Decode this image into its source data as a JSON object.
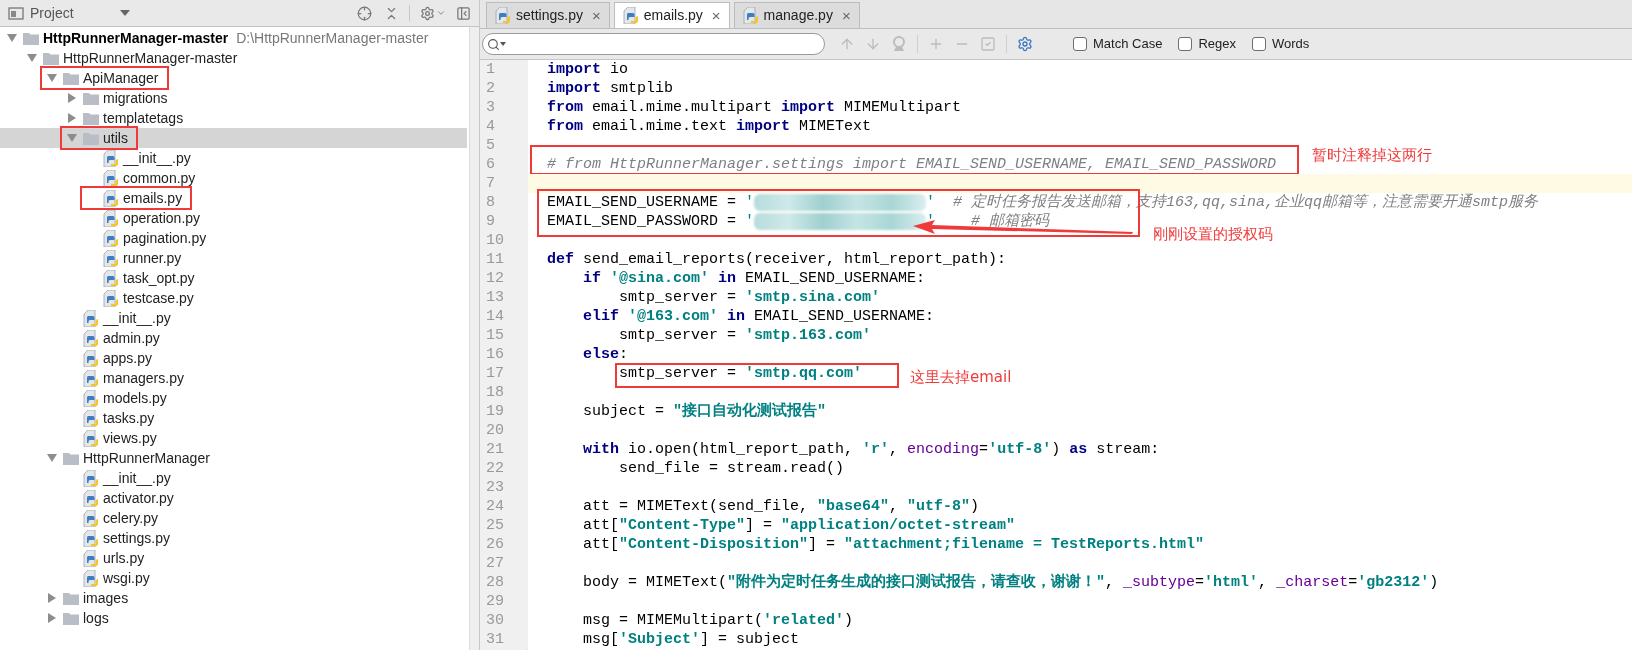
{
  "project_panel": {
    "title": "Project",
    "tree": [
      {
        "label": "HttpRunnerManager-master",
        "path": "D:\\HttpRunnerManager-master",
        "kind": "folder",
        "expanded": true,
        "selected": false,
        "boxed": false,
        "children": [
          {
            "label": "HttpRunnerManager-master",
            "kind": "folder",
            "expanded": true,
            "selected": false,
            "boxed": false,
            "children": [
              {
                "label": "ApiManager",
                "kind": "folder",
                "expanded": true,
                "selected": false,
                "boxed": true,
                "children": [
                  {
                    "label": "migrations",
                    "kind": "folder",
                    "expanded": false,
                    "selected": false,
                    "boxed": false
                  },
                  {
                    "label": "templatetags",
                    "kind": "folder",
                    "expanded": false,
                    "selected": false,
                    "boxed": false
                  },
                  {
                    "label": "utils",
                    "kind": "folder",
                    "expanded": true,
                    "selected": true,
                    "boxed": true,
                    "children": [
                      {
                        "label": "__init__.py",
                        "kind": "python",
                        "selected": false,
                        "boxed": false
                      },
                      {
                        "label": "common.py",
                        "kind": "python",
                        "selected": false,
                        "boxed": false
                      },
                      {
                        "label": "emails.py",
                        "kind": "python",
                        "selected": false,
                        "boxed": true
                      },
                      {
                        "label": "operation.py",
                        "kind": "python",
                        "selected": false,
                        "boxed": false
                      },
                      {
                        "label": "pagination.py",
                        "kind": "python",
                        "selected": false,
                        "boxed": false
                      },
                      {
                        "label": "runner.py",
                        "kind": "python",
                        "selected": false,
                        "boxed": false
                      },
                      {
                        "label": "task_opt.py",
                        "kind": "python",
                        "selected": false,
                        "boxed": false
                      },
                      {
                        "label": "testcase.py",
                        "kind": "python",
                        "selected": false,
                        "boxed": false
                      }
                    ]
                  },
                  {
                    "label": "__init__.py",
                    "kind": "python",
                    "selected": false,
                    "boxed": false
                  },
                  {
                    "label": "admin.py",
                    "kind": "python",
                    "selected": false,
                    "boxed": false
                  },
                  {
                    "label": "apps.py",
                    "kind": "python",
                    "selected": false,
                    "boxed": false
                  },
                  {
                    "label": "managers.py",
                    "kind": "python",
                    "selected": false,
                    "boxed": false
                  },
                  {
                    "label": "models.py",
                    "kind": "python",
                    "selected": false,
                    "boxed": false
                  },
                  {
                    "label": "tasks.py",
                    "kind": "python",
                    "selected": false,
                    "boxed": false
                  },
                  {
                    "label": "views.py",
                    "kind": "python",
                    "selected": false,
                    "boxed": false
                  }
                ]
              },
              {
                "label": "HttpRunnerManager",
                "kind": "folder",
                "expanded": true,
                "selected": false,
                "boxed": false,
                "children": [
                  {
                    "label": "__init__.py",
                    "kind": "python",
                    "selected": false,
                    "boxed": false
                  },
                  {
                    "label": "activator.py",
                    "kind": "python",
                    "selected": false,
                    "boxed": false
                  },
                  {
                    "label": "celery.py",
                    "kind": "python",
                    "selected": false,
                    "boxed": false
                  },
                  {
                    "label": "settings.py",
                    "kind": "python",
                    "selected": false,
                    "boxed": false
                  },
                  {
                    "label": "urls.py",
                    "kind": "python",
                    "selected": false,
                    "boxed": false
                  },
                  {
                    "label": "wsgi.py",
                    "kind": "python",
                    "selected": false,
                    "boxed": false
                  }
                ]
              },
              {
                "label": "images",
                "kind": "folder",
                "expanded": false,
                "selected": false,
                "boxed": false
              },
              {
                "label": "logs",
                "kind": "folder",
                "expanded": false,
                "selected": false,
                "boxed": false
              }
            ]
          }
        ]
      }
    ]
  },
  "editor": {
    "tabs": [
      {
        "label": "settings.py",
        "selected": false,
        "close": "×"
      },
      {
        "label": "emails.py",
        "selected": true,
        "close": "×"
      },
      {
        "label": "manage.py",
        "selected": false,
        "close": "×"
      }
    ],
    "find_bar": {
      "options": [
        {
          "label": "Match Case",
          "checked": false
        },
        {
          "label": "Regex",
          "checked": false
        },
        {
          "label": "Words",
          "checked": false
        }
      ]
    },
    "code": {
      "groups": [
        {
          "boxed": false,
          "lines": [
            {
              "number": "1",
              "current": false,
              "tokens": [
                {
                  "kind": "k",
                  "text": "import"
                },
                {
                  "kind": "p",
                  "text": " io"
                }
              ]
            },
            {
              "number": "2",
              "current": false,
              "tokens": [
                {
                  "kind": "k",
                  "text": "import"
                },
                {
                  "kind": "p",
                  "text": " smtplib"
                }
              ]
            },
            {
              "number": "3",
              "current": false,
              "tokens": [
                {
                  "kind": "k",
                  "text": "from"
                },
                {
                  "kind": "p",
                  "text": " email.mime.multipart "
                },
                {
                  "kind": "k",
                  "text": "import"
                },
                {
                  "kind": "p",
                  "text": " MIMEMultipart"
                }
              ]
            },
            {
              "number": "4",
              "current": false,
              "tokens": [
                {
                  "kind": "k",
                  "text": "from"
                },
                {
                  "kind": "p",
                  "text": " email.mime.text "
                },
                {
                  "kind": "k",
                  "text": "import"
                },
                {
                  "kind": "p",
                  "text": " MIMEText"
                }
              ]
            }
          ]
        },
        {
          "boxed": true,
          "pointer": false,
          "note": "暂时注释掉这两行",
          "lines": [
            {
              "number": "5",
              "current": false
            },
            {
              "number": "6",
              "current": false,
              "tokens": [
                {
                  "kind": "c",
                  "text": "# from HttpRunnerManager.settings import EMAIL_SEND_USERNAME, EMAIL_SEND_PASSWORD"
                }
              ]
            }
          ]
        },
        {
          "boxed": false,
          "lines": [
            {
              "number": "7",
              "current": true
            }
          ]
        },
        {
          "boxed": true,
          "pointer": true,
          "note": "刚刚设置的授权码",
          "lines": [
            {
              "number": "8",
              "current": false,
              "tokens": [
                {
                  "kind": "p",
                  "text": "EMAIL_SEND_USERNAME = "
                },
                {
                  "kind": "q",
                  "text": "'"
                },
                {
                  "kind": "r"
                },
                {
                  "kind": "q",
                  "text": "'"
                },
                {
                  "kind": "c",
                  "text": "  # 定时任务报告发送邮箱，支持163,qq,sina,企业qq邮箱等，注意需要开通smtp服务"
                }
              ]
            },
            {
              "number": "9",
              "current": false,
              "tokens": [
                {
                  "kind": "p",
                  "text": "EMAIL_SEND_PASSWORD = "
                },
                {
                  "kind": "q",
                  "text": "'"
                },
                {
                  "kind": "r"
                },
                {
                  "kind": "q",
                  "text": "'"
                },
                {
                  "kind": "c",
                  "text": "    # 邮箱密码"
                }
              ]
            }
          ]
        },
        {
          "boxed": false,
          "lines": [
            {
              "number": "10",
              "current": false
            },
            {
              "number": "11",
              "current": false,
              "tokens": [
                {
                  "kind": "k",
                  "text": "def"
                },
                {
                  "kind": "p",
                  "text": " send_email_reports(receiver, html_report_path):"
                }
              ]
            },
            {
              "number": "12",
              "current": false,
              "tokens": [
                {
                  "kind": "k",
                  "text": "    if "
                },
                {
                  "kind": "s",
                  "text": "'@sina.com' "
                },
                {
                  "kind": "k",
                  "text": "in"
                },
                {
                  "kind": "p",
                  "text": " EMAIL_SEND_USERNAME:"
                }
              ]
            },
            {
              "number": "13",
              "current": false,
              "tokens": [
                {
                  "kind": "p",
                  "text": "        smtp_server = "
                },
                {
                  "kind": "s",
                  "text": "'smtp.sina.com'"
                }
              ]
            },
            {
              "number": "14",
              "current": false,
              "tokens": [
                {
                  "kind": "k",
                  "text": "    elif "
                },
                {
                  "kind": "s",
                  "text": "'@163.com' "
                },
                {
                  "kind": "k",
                  "text": "in"
                },
                {
                  "kind": "p",
                  "text": " EMAIL_SEND_USERNAME:"
                }
              ]
            },
            {
              "number": "15",
              "current": false,
              "tokens": [
                {
                  "kind": "p",
                  "text": "        smtp_server = "
                },
                {
                  "kind": "s",
                  "text": "'smtp.163.com'"
                }
              ]
            },
            {
              "number": "16",
              "current": false,
              "tokens": [
                {
                  "kind": "k",
                  "text": "    else"
                },
                {
                  "kind": "p",
                  "text": ":"
                }
              ]
            }
          ]
        },
        {
          "boxed": true,
          "pointer": false,
          "note": "这里去掉email",
          "lines": [
            {
              "number": "17",
              "current": false,
              "tokens": [
                {
                  "kind": "p",
                  "text": "        smtp_server = "
                },
                {
                  "kind": "s",
                  "text": "'smtp.qq.com'"
                }
              ]
            }
          ]
        },
        {
          "boxed": false,
          "lines": [
            {
              "number": "18",
              "current": false
            },
            {
              "number": "19",
              "current": false,
              "tokens": [
                {
                  "kind": "p",
                  "text": "    subject = "
                },
                {
                  "kind": "s",
                  "text": "\"接口自动化测试报告\""
                }
              ]
            },
            {
              "number": "20",
              "current": false
            },
            {
              "number": "21",
              "current": false,
              "tokens": [
                {
                  "kind": "k",
                  "text": "    with"
                },
                {
                  "kind": "p",
                  "text": " io.open(html_report_path, "
                },
                {
                  "kind": "s",
                  "text": "'r'"
                },
                {
                  "kind": "p",
                  "text": ", "
                },
                {
                  "kind": "a",
                  "text": "encoding"
                },
                {
                  "kind": "p",
                  "text": "="
                },
                {
                  "kind": "s",
                  "text": "'utf-8'"
                },
                {
                  "kind": "p",
                  "text": ") "
                },
                {
                  "kind": "k",
                  "text": "as"
                },
                {
                  "kind": "p",
                  "text": " stream:"
                }
              ]
            },
            {
              "number": "22",
              "current": false,
              "tokens": [
                {
                  "kind": "p",
                  "text": "        send_file = stream.read()"
                }
              ]
            },
            {
              "number": "23",
              "current": false
            },
            {
              "number": "24",
              "current": false,
              "tokens": [
                {
                  "kind": "p",
                  "text": "    att = MIMEText(send_file, "
                },
                {
                  "kind": "s",
                  "text": "\"base64\""
                },
                {
                  "kind": "p",
                  "text": ", "
                },
                {
                  "kind": "s",
                  "text": "\"utf-8\""
                },
                {
                  "kind": "p",
                  "text": ")"
                }
              ]
            },
            {
              "number": "25",
              "current": false,
              "tokens": [
                {
                  "kind": "p",
                  "text": "    att["
                },
                {
                  "kind": "s",
                  "text": "\"Content-Type\""
                },
                {
                  "kind": "p",
                  "text": "] = "
                },
                {
                  "kind": "s",
                  "text": "\"application/octet-stream\""
                }
              ]
            },
            {
              "number": "26",
              "current": false,
              "tokens": [
                {
                  "kind": "p",
                  "text": "    att["
                },
                {
                  "kind": "s",
                  "text": "\"Content-Disposition\""
                },
                {
                  "kind": "p",
                  "text": "] = "
                },
                {
                  "kind": "s",
                  "text": "\"attachment;filename = TestReports.html\""
                }
              ]
            },
            {
              "number": "27",
              "current": false
            },
            {
              "number": "28",
              "current": false,
              "tokens": [
                {
                  "kind": "p",
                  "text": "    body = MIMEText("
                },
                {
                  "kind": "s",
                  "text": "\"附件为定时任务生成的接口测试报告，请查收，谢谢！\""
                },
                {
                  "kind": "p",
                  "text": ", "
                },
                {
                  "kind": "a",
                  "text": "_subtype"
                },
                {
                  "kind": "p",
                  "text": "="
                },
                {
                  "kind": "s",
                  "text": "'html'"
                },
                {
                  "kind": "p",
                  "text": ", "
                },
                {
                  "kind": "a",
                  "text": "_charset"
                },
                {
                  "kind": "p",
                  "text": "="
                },
                {
                  "kind": "s",
                  "text": "'gb2312'"
                },
                {
                  "kind": "p",
                  "text": ")"
                }
              ]
            },
            {
              "number": "29",
              "current": false
            },
            {
              "number": "30",
              "current": false,
              "tokens": [
                {
                  "kind": "p",
                  "text": "    msg = MIMEMultipart("
                },
                {
                  "kind": "s",
                  "text": "'related'"
                },
                {
                  "kind": "p",
                  "text": ")"
                }
              ]
            },
            {
              "number": "31",
              "current": false,
              "tokens": [
                {
                  "kind": "p",
                  "text": "    msg["
                },
                {
                  "kind": "s",
                  "text": "'Subject'"
                },
                {
                  "kind": "p",
                  "text": "] = subject"
                }
              ]
            }
          ]
        }
      ]
    }
  }
}
